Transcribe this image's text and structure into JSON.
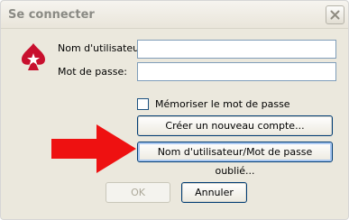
{
  "window": {
    "title": "Se connecter"
  },
  "icons": {
    "close": "close-icon",
    "logo": "spade-logo-icon",
    "arrow": "red-arrow-icon"
  },
  "colors": {
    "arrow": "#ee1111",
    "logo": "#c8102e",
    "button_border": "#003c74"
  },
  "form": {
    "username_label": "Nom d'utilisateur:",
    "username_value": "",
    "password_label": "Mot de passe:",
    "password_value": "",
    "remember_label": "Mémoriser le mot de passe",
    "remember_checked": false
  },
  "buttons": {
    "create_account": "Créer un nouveau compte...",
    "forgot": "Nom d'utilisateur/Mot de passe oublié...",
    "ok": "OK",
    "cancel": "Annuler"
  }
}
